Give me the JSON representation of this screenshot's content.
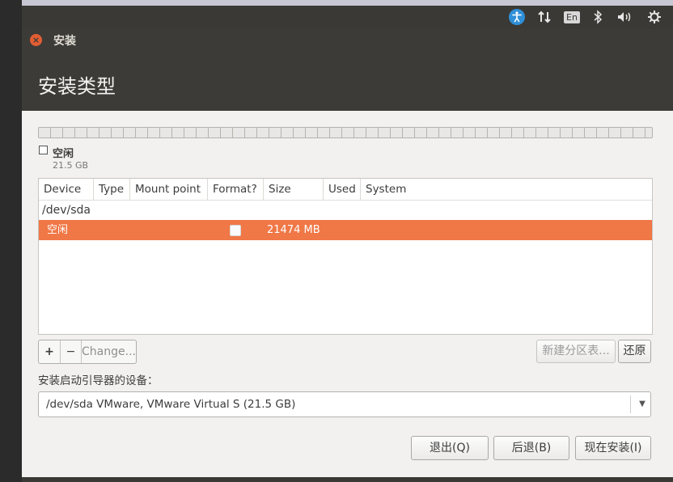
{
  "window": {
    "title": "安装",
    "page_title": "安装类型"
  },
  "menubar": {
    "icons": [
      "accessibility-icon",
      "network-icon",
      "keyboard-layout-icon",
      "bluetooth-icon",
      "volume-icon",
      "settings-icon"
    ],
    "keyboard_layout": "En"
  },
  "partition_bar": {
    "legend_label": "空闲",
    "legend_size": "21.5 GB"
  },
  "table": {
    "columns": [
      "Device",
      "Type",
      "Mount point",
      "Format?",
      "Size",
      "Used",
      "System"
    ],
    "device": "/dev/sda",
    "rows": [
      {
        "device": "空闲",
        "type": "",
        "mount_point": "",
        "format": false,
        "size": "21474 MB",
        "used": "",
        "system": ""
      }
    ]
  },
  "toolbar": {
    "add_label": "+",
    "remove_label": "−",
    "change_label": "Change...",
    "new_table_label": "新建分区表...",
    "revert_label": "还原"
  },
  "bootloader": {
    "label": "安装启动引导器的设备：",
    "value": "/dev/sda  VMware, VMware Virtual S (21.5 GB)"
  },
  "footer": {
    "quit_label": "退出(Q)",
    "back_label": "后退(B)",
    "install_label": "现在安装(I)"
  },
  "colors": {
    "accent": "#f07746",
    "titlebar": "#3c3b37",
    "menubar": "#3a3935",
    "close_button": "#e25d33"
  }
}
